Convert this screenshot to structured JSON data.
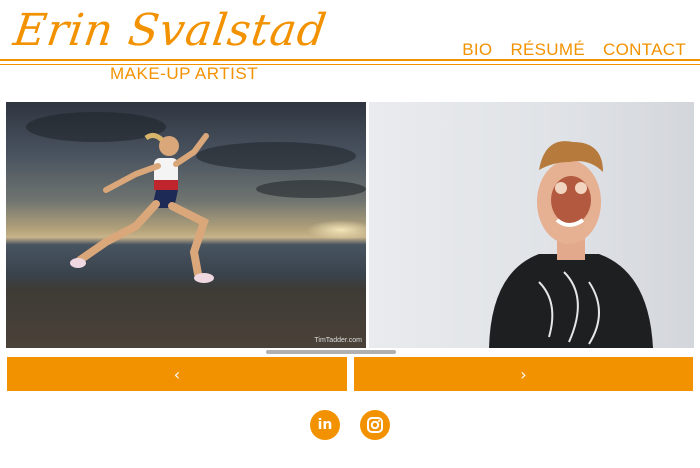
{
  "brand": {
    "name": "Erin Svalstad",
    "tagline": "MAKE-UP ARTIST",
    "color": "#f39200"
  },
  "nav": {
    "items": [
      {
        "label": "BIO"
      },
      {
        "label": "RÉSUMÉ"
      },
      {
        "label": "CONTACT"
      }
    ]
  },
  "gallery": {
    "left_photo": {
      "credit": "TimTadder.com",
      "subject": "sprinting athlete on beach at sunset"
    },
    "right_photo": {
      "subject": "man with special-effects face make-up"
    }
  },
  "controls": {
    "prev_label": "‹",
    "next_label": "›"
  },
  "social": {
    "linkedin_label": "in",
    "icons": [
      "linkedin-icon",
      "instagram-icon"
    ]
  }
}
